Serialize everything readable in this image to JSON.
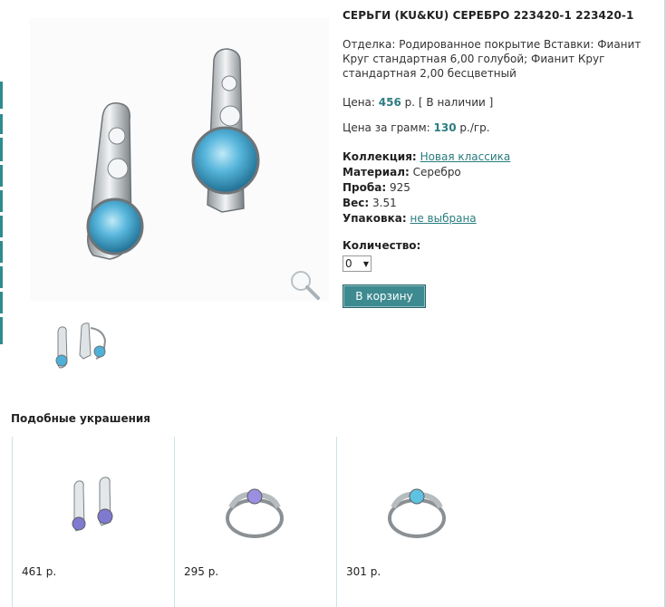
{
  "product": {
    "title": "СЕРЬГИ (KU&KU) СЕРЕБРО 223420-1 223420-1",
    "description": "Отделка: Родированное покрытие Вставки: Фианит Круг стандартная 6,00 голубой; Фианит Круг стандартная 2,00 бесцветный",
    "price_label": "Цена:",
    "price_value": "456",
    "price_suffix": "р. [ В наличии ]",
    "gram_label": "Цена за грамм:",
    "gram_value": "130",
    "gram_suffix": "р./гр.",
    "attributes": {
      "collection_label": "Коллекция:",
      "collection_value": "Новая классика",
      "material_label": "Материал:",
      "material_value": "Серебро",
      "proba_label": "Проба:",
      "proba_value": "925",
      "weight_label": "Вес:",
      "weight_value": "3.51",
      "package_label": "Упаковка:",
      "package_value": "не выбрана"
    },
    "quantity_label": "Количество:",
    "quantity_value": "0",
    "cart_button": "В корзину"
  },
  "similar": {
    "title": "Подобные украшения",
    "items": [
      {
        "price": "461 р.",
        "icon": "earrings-icon",
        "stone": "#7f7ad0"
      },
      {
        "price": "295 р.",
        "icon": "ring-icon",
        "stone": "#9a8fe0"
      },
      {
        "price": "301 р.",
        "icon": "ring-icon",
        "stone": "#5ec3e0"
      }
    ]
  },
  "colors": {
    "accent": "#2e7d80",
    "button": "#3d8a90",
    "main_stone": "#4fb0d8"
  }
}
